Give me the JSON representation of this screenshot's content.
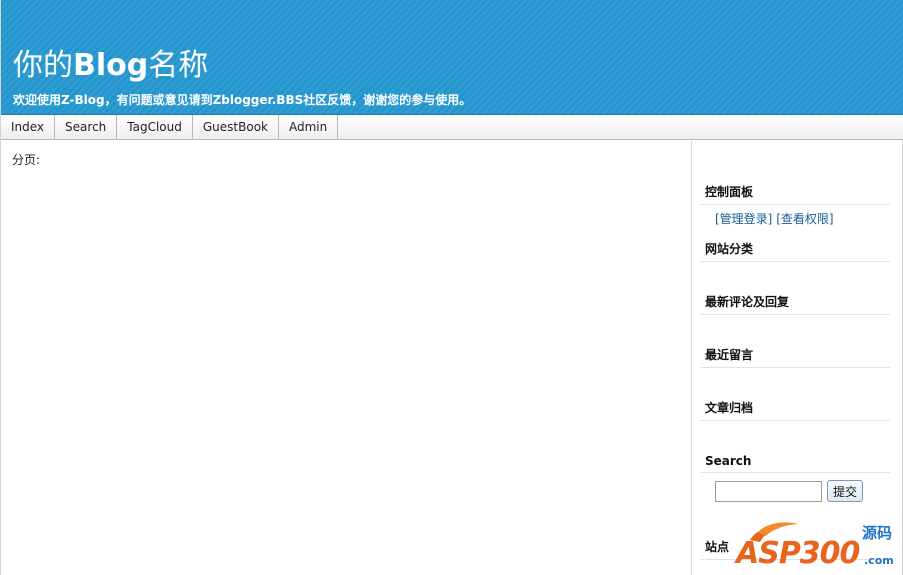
{
  "header": {
    "title_pre": "你的",
    "title_mid": "Blog",
    "title_post": "名称",
    "subtitle": "欢迎使用Z-Blog，有问题或意见请到Zblogger.BBS社区反馈，谢谢您的参与使用。",
    "bg_color": "#2496cf"
  },
  "nav": {
    "items": [
      "Index",
      "Search",
      "TagCloud",
      "GuestBook",
      "Admin"
    ]
  },
  "content": {
    "pager_label": "分页:"
  },
  "sidebar": {
    "control_panel_title": "控制面板",
    "login_link": "[管理登录]",
    "permissions_link": "[查看权限]",
    "categories_title": "网站分类",
    "comments_title": "最新评论及回复",
    "guestbook_title": "最近留言",
    "archives_title": "文章归档",
    "search_title": "Search",
    "search_value": "",
    "search_button": "提交",
    "site_title": "站点"
  },
  "watermark": {
    "text": "ASP300",
    "side_text": "源码",
    "domain": ".com"
  }
}
